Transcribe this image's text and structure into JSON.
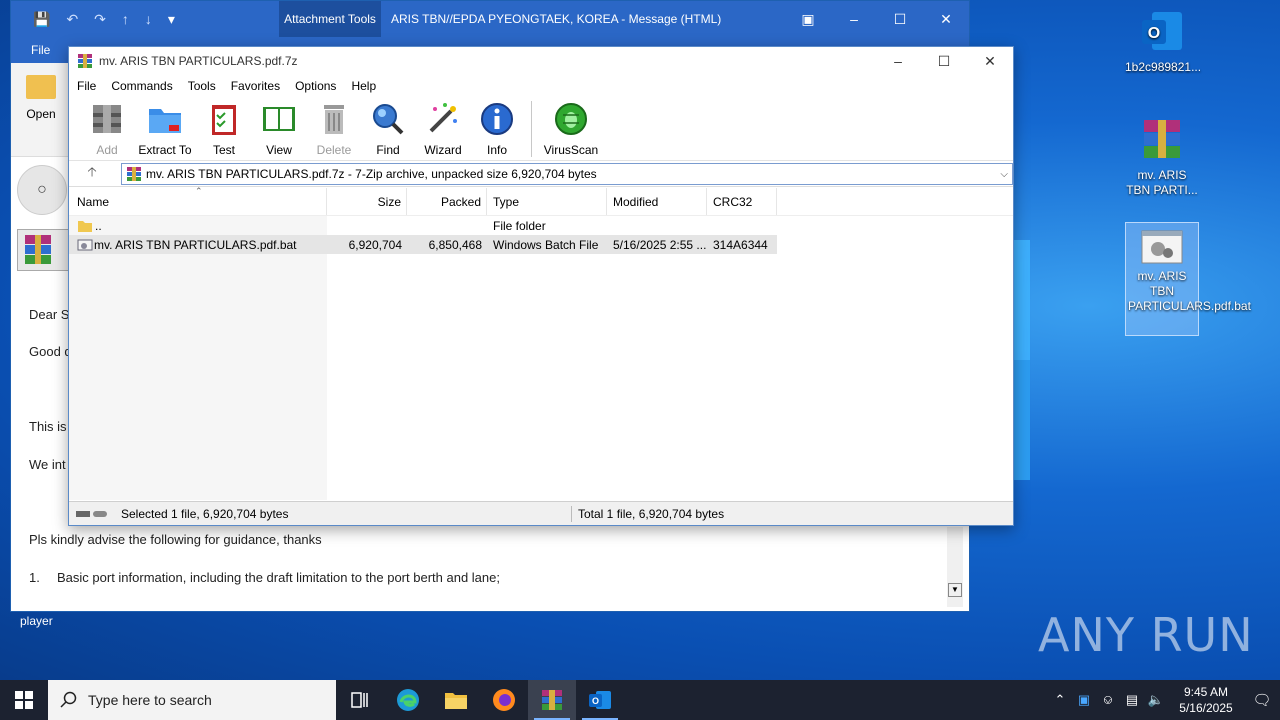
{
  "outlook": {
    "quick_access_icons": [
      "save-icon",
      "undo-icon",
      "redo-icon",
      "up-icon",
      "down-icon",
      "customize-icon"
    ],
    "contextual_tab": "Attachment Tools",
    "window_title": "ARIS TBN//EPDA PYEONGTAEK, KOREA  -  Message (HTML)",
    "file_tab": "File",
    "open_label": "Open",
    "body": {
      "greeting": "Dear Si",
      "good": "Good d",
      "this_is": "This is",
      "we_int": "We int",
      "advise": "Pls kindly advise the following for guidance, thanks",
      "item_num": "1.",
      "item_text": "Basic port information, including the draft limitation to the port berth and lane;"
    },
    "player_label": "player"
  },
  "zip": {
    "title": "mv. ARIS TBN PARTICULARS.pdf.7z",
    "menu": [
      "File",
      "Commands",
      "Tools",
      "Favorites",
      "Options",
      "Help"
    ],
    "toolbar": {
      "add": "Add",
      "extract": "Extract To",
      "test": "Test",
      "view": "View",
      "delete": "Delete",
      "find": "Find",
      "wizard": "Wizard",
      "info": "Info",
      "virusscan": "VirusScan"
    },
    "path": "mv. ARIS TBN PARTICULARS.pdf.7z - 7-Zip archive, unpacked size 6,920,704 bytes",
    "columns": [
      "Name",
      "Size",
      "Packed",
      "Type",
      "Modified",
      "CRC32"
    ],
    "rows": [
      {
        "name": "..",
        "size": "",
        "packed": "",
        "type": "File folder",
        "modified": "",
        "crc": ""
      },
      {
        "name": "mv. ARIS TBN PARTICULARS.pdf.bat",
        "size": "6,920,704",
        "packed": "6,850,468",
        "type": "Windows Batch File",
        "modified": "5/16/2025 2:55 ...",
        "crc": "314A6344"
      }
    ],
    "status_left": "Selected 1 file, 6,920,704 bytes",
    "status_right": "Total 1 file, 6,920,704 bytes"
  },
  "desktop": {
    "icons": [
      {
        "label": "1b2c989821..."
      },
      {
        "label": "mv. ARIS TBN PARTI..."
      },
      {
        "label": "mv. ARIS TBN PARTICULARS.pdf.bat"
      }
    ],
    "watermark": "ANY RUN"
  },
  "taskbar": {
    "search_placeholder": "Type here to search",
    "time": "9:45 AM",
    "date": "5/16/2025"
  }
}
